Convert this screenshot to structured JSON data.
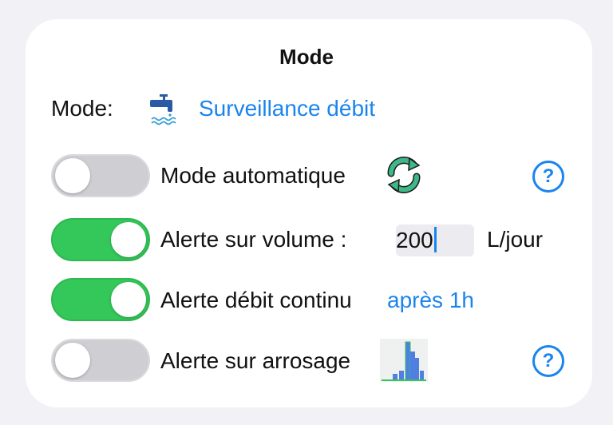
{
  "header": {
    "title": "Mode"
  },
  "mode": {
    "label": "Mode:",
    "icon": "water-tap-icon",
    "current": "Surveillance débit"
  },
  "rows": {
    "auto": {
      "label": "Mode automatique",
      "toggle_on": false,
      "icon": "sync-icon"
    },
    "volume": {
      "label": "Alerte sur volume  :",
      "toggle_on": true,
      "value": "200",
      "unit": "L/jour"
    },
    "continuous": {
      "label": "Alerte débit continu",
      "toggle_on": true,
      "delay": "après 1h"
    },
    "watering": {
      "label": "Alerte sur arrosage",
      "toggle_on": false,
      "icon": "histogram-icon"
    }
  },
  "help_symbol": "?",
  "colors": {
    "accent": "#1a84ee",
    "toggle_on": "#34c759",
    "toggle_off": "#cfcfd3",
    "sync_green": "#3db888"
  }
}
